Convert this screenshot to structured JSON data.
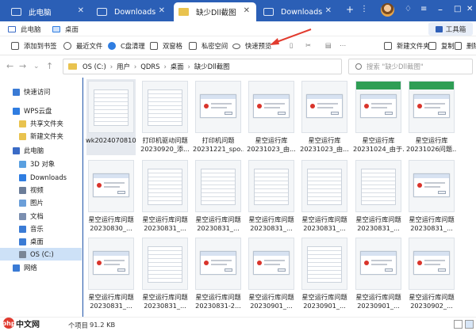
{
  "tabs": [
    {
      "label": "此电脑",
      "active": false
    },
    {
      "label": "Downloads",
      "active": false
    },
    {
      "label": "缺少Dll截图",
      "active": true
    },
    {
      "label": "Downloads",
      "active": false
    }
  ],
  "bookmarks": [
    "此电脑",
    "桌面"
  ],
  "toolbox_label": "工具箱",
  "commands": [
    "添加到书签",
    "最近文件",
    "C盘清理",
    "双窗格",
    "私密空间",
    "快速预览",
    "新建文件夹",
    "复制",
    "删除"
  ],
  "address": {
    "crumbs": [
      "OS (C:)",
      "用户",
      "QDRS",
      "桌面",
      "缺少Dll截图"
    ]
  },
  "search_placeholder": "搜索 \"缺少Dll截图\"",
  "sidebar": [
    {
      "label": "快速访问",
      "color": "#3a7bd5"
    },
    {
      "label": "WPS云盘",
      "color": "#2f7de1"
    },
    {
      "label": "共享文件夹",
      "color": "#e9c34f"
    },
    {
      "label": "新建文件夹",
      "color": "#e9c34f"
    },
    {
      "label": "此电脑",
      "color": "#3a6bc6"
    },
    {
      "label": "3D 对象",
      "color": "#5aa0e0"
    },
    {
      "label": "Downloads",
      "color": "#2f7de1"
    },
    {
      "label": "视频",
      "color": "#6b7d99"
    },
    {
      "label": "图片",
      "color": "#6b9fd9"
    },
    {
      "label": "文档",
      "color": "#7b8fb0"
    },
    {
      "label": "音乐",
      "color": "#3a7bd5"
    },
    {
      "label": "桌面",
      "color": "#3a7bd5"
    },
    {
      "label": "OS (C:)",
      "color": "#7a8696",
      "selected": true
    },
    {
      "label": "网络",
      "color": "#3a7bd5"
    }
  ],
  "files": [
    {
      "line1": "wk2024070810...",
      "line2": "",
      "kind": "web"
    },
    {
      "line1": "打印机驱动问题",
      "line2": "20230920_添...",
      "kind": "doc"
    },
    {
      "line1": "打印机问题",
      "line2": "20231221_spo...",
      "kind": "err"
    },
    {
      "line1": "星空运行库",
      "line2": "20231023_由...",
      "kind": "err"
    },
    {
      "line1": "星空运行库",
      "line2": "20231023_由...",
      "kind": "err"
    },
    {
      "line1": "星空运行库",
      "line2": "20231024_由于...",
      "kind": "green"
    },
    {
      "line1": "星空运行库",
      "line2": "20231026问题...",
      "kind": "green"
    },
    {
      "line1": "星空运行库问题",
      "line2": "20230830_...",
      "kind": "err"
    },
    {
      "line1": "星空运行库问题",
      "line2": "20230831_...",
      "kind": "doc"
    },
    {
      "line1": "星空运行库问题",
      "line2": "20230831_...",
      "kind": "doc"
    },
    {
      "line1": "星空运行库问题",
      "line2": "20230831_...",
      "kind": "doc"
    },
    {
      "line1": "星空运行库问题",
      "line2": "20230831_...",
      "kind": "doc"
    },
    {
      "line1": "星空运行库问题",
      "line2": "20230831_...",
      "kind": "doc"
    },
    {
      "line1": "星空运行库问题",
      "line2": "20230831_...",
      "kind": "err"
    },
    {
      "line1": "星空运行库问题",
      "line2": "20230831_...",
      "kind": "err"
    },
    {
      "line1": "星空运行库问题",
      "line2": "20230831_...",
      "kind": "doc"
    },
    {
      "line1": "星空运行库问题",
      "line2": "20230831-2...",
      "kind": "err"
    },
    {
      "line1": "星空运行库问题",
      "line2": "20230901_...",
      "kind": "err"
    },
    {
      "line1": "星空运行库问题",
      "line2": "20230901_...",
      "kind": "doc"
    },
    {
      "line1": "星空运行库问题",
      "line2": "20230901_...",
      "kind": "err"
    },
    {
      "line1": "星空运行库问题",
      "line2": "20230902_...",
      "kind": "err"
    }
  ],
  "status": {
    "count": "个项目",
    "size": "91.2 KB"
  },
  "logo_text": "中文网",
  "logo_mark": "php"
}
